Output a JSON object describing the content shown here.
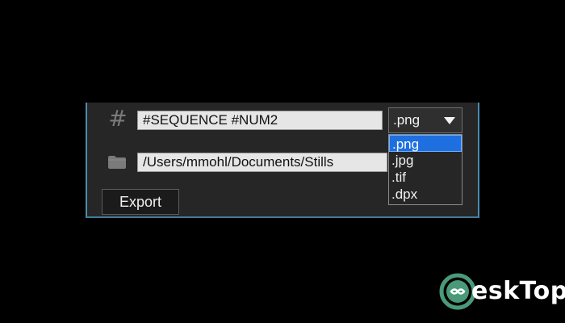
{
  "form": {
    "name_icon": "hash-icon",
    "name_value": "#SEQUENCE #NUM2",
    "path_icon": "folder-icon",
    "path_value": "/Users/mmohl/Documents/Stills",
    "export_label": "Export"
  },
  "format_select": {
    "selected": ".png",
    "options": [
      ".png",
      ".jpg",
      ".tif",
      ".dpx"
    ],
    "highlighted_index": 0
  },
  "watermark": {
    "text": "eskTop"
  },
  "colors": {
    "panel_border": "#4a8db0",
    "selection": "#1e6fe0",
    "watermark_green": "#4a9a7a"
  }
}
